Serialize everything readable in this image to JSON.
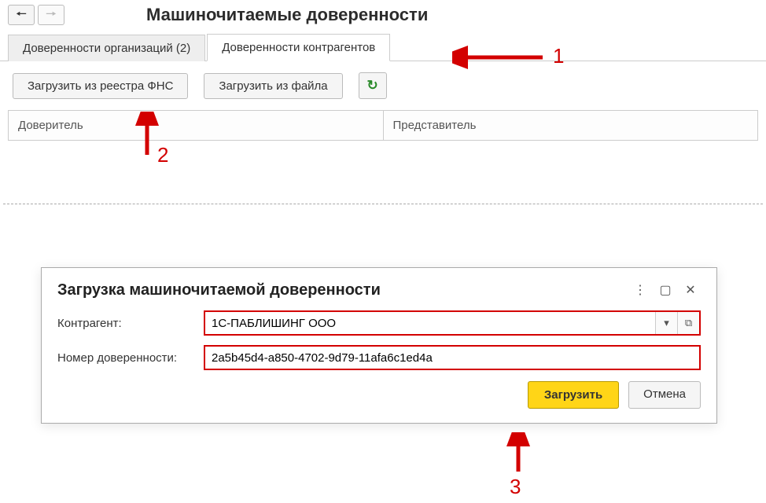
{
  "header": {
    "title": "Машиночитаемые доверенности"
  },
  "tabs": {
    "org": "Доверенности организаций (2)",
    "contr": "Доверенности контрагентов"
  },
  "toolbar": {
    "load_fns": "Загрузить из реестра ФНС",
    "load_file": "Загрузить из файла"
  },
  "table": {
    "col1": "Доверитель",
    "col2": "Представитель"
  },
  "dialog": {
    "title": "Загрузка машиночитаемой доверенности",
    "contragent_label": "Контрагент:",
    "contragent_value": "1С-ПАБЛИШИНГ ООО",
    "number_label": "Номер доверенности:",
    "number_value": "2a5b45d4-a850-4702-9d79-11afa6c1ed4a",
    "submit": "Загрузить",
    "cancel": "Отмена"
  },
  "annotations": {
    "a1": "1",
    "a2": "2",
    "a3": "3"
  }
}
